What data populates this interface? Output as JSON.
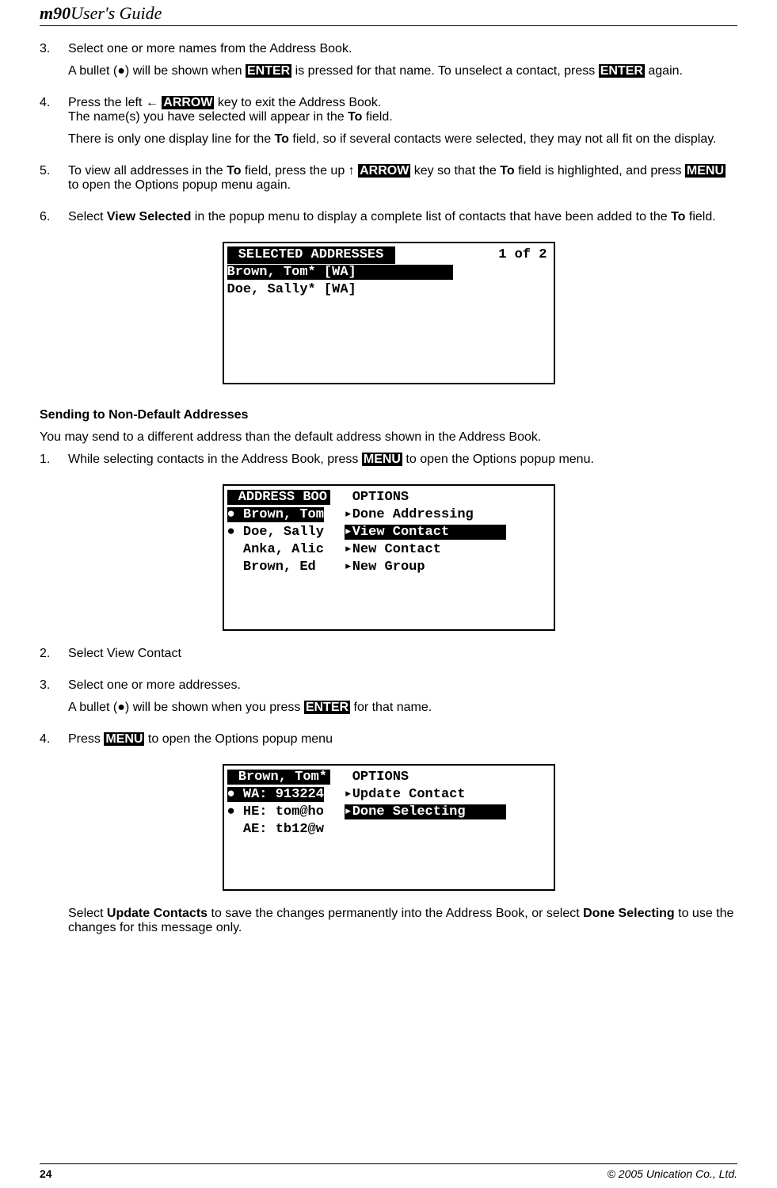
{
  "header": {
    "prefix": "m90",
    "title": "User's Guide"
  },
  "steps_a": [
    {
      "num": "3.",
      "lines": [
        "Select one or more names from the Address Book."
      ],
      "extra_html": "bullet_enter"
    },
    {
      "num": "4.",
      "lines": [],
      "extra_html": "left_arrow"
    },
    {
      "num": "5.",
      "extra_html": "up_arrow"
    },
    {
      "num": "6.",
      "extra_html": "view_selected"
    }
  ],
  "text": {
    "bullet_enter_1": "A bullet (●) will be shown when ",
    "bullet_enter_2": " is pressed for that name. To unselect a contact, press ",
    "bullet_enter_3": " again.",
    "left_arrow_1": "Press the left ← ",
    "left_arrow_2": " key to exit the Address Book.",
    "left_arrow_3": "The name(s) you have selected will appear in the ",
    "left_arrow_4": " field.",
    "left_arrow_5": "There is only one display line for the ",
    "left_arrow_6": " field, so if several contacts were selected, they may not all fit on the display.",
    "up_arrow_1": "To view all addresses in the ",
    "up_arrow_2": " field, press the up ↑ ",
    "up_arrow_3": " key so that the ",
    "up_arrow_4": " field is highlighted, and press ",
    "up_arrow_5": " to open the Options popup menu again.",
    "view_sel_1": "Select ",
    "view_sel_2": " in the popup menu to display a complete list of contacts that have been added to the ",
    "view_sel_3": " field.",
    "section_h": "Sending to Non-Default Addresses",
    "section_p": "You may send to a different address than the default address shown in the Address Book.",
    "s2_1_a": "While selecting contacts in the Address Book, press ",
    "s2_1_b": " to open the Options popup menu.",
    "s2_2": "Select View Contact",
    "s2_3": "Select one or more addresses.",
    "s2_3b_a": "A bullet (●) will be shown when you press ",
    "s2_3b_b": " for that name.",
    "s2_4_a": "Press ",
    "s2_4_b": " to open the Options popup menu",
    "final_a": "Select ",
    "final_b": " to save the changes permanently into the Address Book, or select ",
    "final_c": " to use the changes for this message only."
  },
  "keys": {
    "enter": "ENTER",
    "arrow": "ARROW",
    "menu": "MENU"
  },
  "bold": {
    "to": "To",
    "view_selected": "View Selected",
    "update_contacts": "Update Contacts",
    "done_selecting": "Done Selecting"
  },
  "screen1": {
    "title": " SELECTED ADDRESSES ",
    "count": "1 of 2",
    "row1": "Brown, Tom* [WA]",
    "row2": "Doe, Sally* [WA]"
  },
  "screen2": {
    "left_title": " ADDRESS BOO",
    "left_r1": "● Brown, Tom",
    "left_r2": "● Doe, Sally",
    "left_r3": "  Anka, Alic",
    "left_r4": "  Brown, Ed",
    "right_title": " OPTIONS",
    "right_r1": "▸Done Addressing",
    "right_r2": "▸View Contact",
    "right_r3": "▸New Contact",
    "right_r4": "▸New Group"
  },
  "screen3": {
    "left_title": " Brown, Tom*",
    "left_r1": "● WA: 913224",
    "left_r2": "● HE: tom@ho",
    "left_r3": "  AE: tb12@w",
    "right_title": " OPTIONS",
    "right_r1": "▸Update Contact",
    "right_r2": "▸Done Selecting"
  },
  "footer": {
    "page": "24",
    "copyright": "© 2005 Unication Co., Ltd."
  },
  "nums": {
    "s2_1": "1.",
    "s2_2": "2.",
    "s2_3": "3.",
    "s2_4": "4."
  }
}
